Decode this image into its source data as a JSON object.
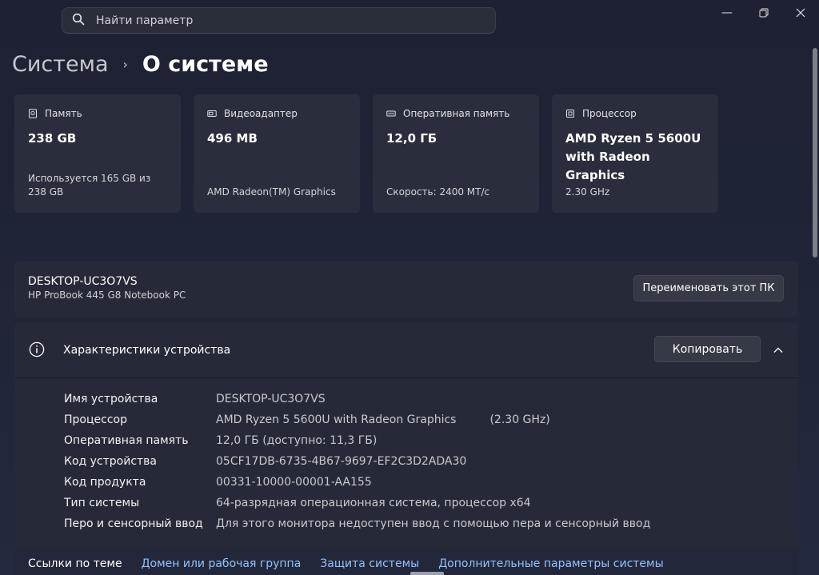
{
  "search": {
    "placeholder": "Найти параметр"
  },
  "window": {
    "minimize": "—"
  },
  "breadcrumb": {
    "parent": "Система",
    "separator": "›",
    "current": "О системе"
  },
  "cards": [
    {
      "icon": "storage-icon",
      "label": "Память",
      "value": "238 GB",
      "sub": "Используется 165 GB из 238 GB"
    },
    {
      "icon": "gpu-icon",
      "label": "Видеоадаптер",
      "value": "496 MB",
      "sub": "AMD Radeon(TM) Graphics"
    },
    {
      "icon": "ram-icon",
      "label": "Оперативная память",
      "value": "12,0 ГБ",
      "sub": "Скорость: 2400 МТ/с"
    },
    {
      "icon": "cpu-icon",
      "label": "Процессор",
      "value": "AMD Ryzen 5 5600U with Radeon Graphics",
      "sub": "2.30 GHz"
    }
  ],
  "device": {
    "name": "DESKTOP-UC3O7VS",
    "model": "HP ProBook 445 G8 Notebook PC",
    "rename_label": "Переименовать этот ПК"
  },
  "specs": {
    "title": "Характеристики устройства",
    "copy_label": "Копировать",
    "rows": [
      {
        "label": "Имя устройства",
        "value": "DESKTOP-UC3O7VS",
        "extra": ""
      },
      {
        "label": "Процессор",
        "value": "AMD Ryzen 5 5600U with Radeon Graphics",
        "extra": "(2.30 GHz)"
      },
      {
        "label": "Оперативная память",
        "value": "12,0 ГБ (доступно: 11,3 ГБ)",
        "extra": ""
      },
      {
        "label": "Код устройства",
        "value": "05CF17DB-6735-4B67-9697-EF2C3D2ADA30",
        "extra": ""
      },
      {
        "label": "Код продукта",
        "value": "00331-10000-00001-AA155",
        "extra": ""
      },
      {
        "label": "Тип системы",
        "value": "64-разрядная операционная система, процессор x64",
        "extra": ""
      },
      {
        "label": "Перо и сенсорный ввод",
        "value": "Для этого монитора недоступен ввод с помощью пера и сенсорный ввод",
        "extra": ""
      }
    ]
  },
  "related": {
    "label": "Ссылки по теме",
    "links": [
      "Домен или рабочая группа",
      "Защита системы",
      "Дополнительные параметры системы"
    ]
  }
}
